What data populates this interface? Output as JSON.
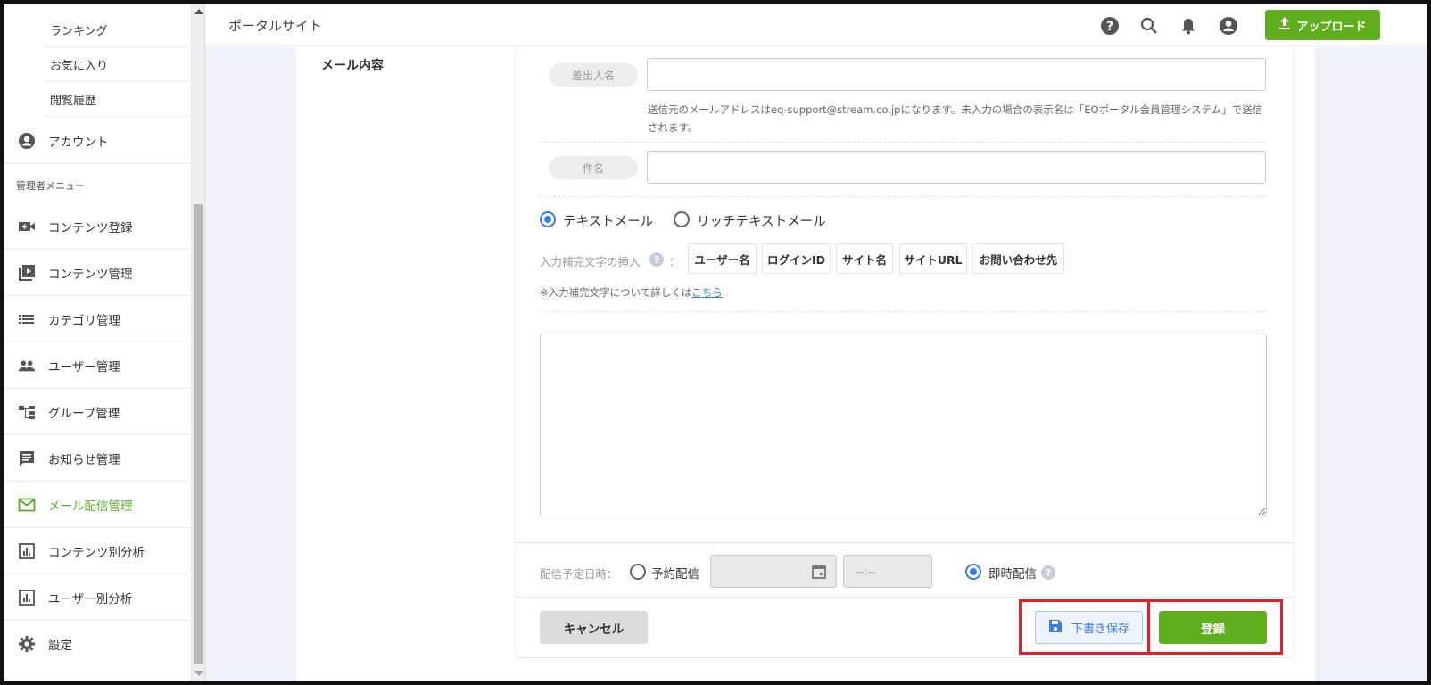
{
  "header": {
    "title": "ポータルサイト",
    "upload_label": "アップロード",
    "upload_button_color": "#5fae1e"
  },
  "sidebar": {
    "sub_items": [
      {
        "label": "ランキング"
      },
      {
        "label": "お気に入り"
      },
      {
        "label": "閲覧履歴"
      }
    ],
    "account_label": "アカウント",
    "admin_menu_label": "管理者メニュー",
    "items": [
      {
        "label": "コンテンツ登録",
        "icon": "video-add-icon"
      },
      {
        "label": "コンテンツ管理",
        "icon": "video-library-icon"
      },
      {
        "label": "カテゴリ管理",
        "icon": "list-icon"
      },
      {
        "label": "ユーザー管理",
        "icon": "people-icon"
      },
      {
        "label": "グループ管理",
        "icon": "hierarchy-icon"
      },
      {
        "label": "お知らせ管理",
        "icon": "notice-icon"
      },
      {
        "label": "メール配信管理",
        "icon": "mail-icon",
        "active": true
      },
      {
        "label": "コンテンツ別分析",
        "icon": "chart-icon"
      },
      {
        "label": "ユーザー別分析",
        "icon": "chart-icon"
      },
      {
        "label": "設定",
        "icon": "gear-icon"
      }
    ],
    "active_color": "#5aaa2a"
  },
  "form": {
    "section_label": "メール内容",
    "sender_label": "差出人名",
    "sender_value": "",
    "sender_help": "送信元のメールアドレスはeq-support@stream.co.jpになります。未入力の場合の表示名は「EQポータル会員管理システム」で送信されます。",
    "subject_label": "件名",
    "subject_value": "",
    "format_options": [
      {
        "label": "テキストメール",
        "selected": true
      },
      {
        "label": "リッチテキストメール",
        "selected": false
      }
    ],
    "insert_label": "入力補完文字の挿入",
    "insert_colon": "：",
    "insert_chips": [
      "ユーザー名",
      "ログインID",
      "サイト名",
      "サイトURL",
      "お問い合わせ先"
    ],
    "note_prefix": "※入力補完文字について詳しくは",
    "note_link": "こちら",
    "body_value": "",
    "schedule_label": "配信予定日時：",
    "schedule_reserved_label": "予約配信",
    "time_placeholder": "--:--",
    "schedule_immediate_label": "即時配信",
    "cancel_label": "キャンセル",
    "draft_label": "下書き保存",
    "submit_label": "登録",
    "accent_color": "#3b7ddd",
    "highlight_color": "#e0202a"
  }
}
